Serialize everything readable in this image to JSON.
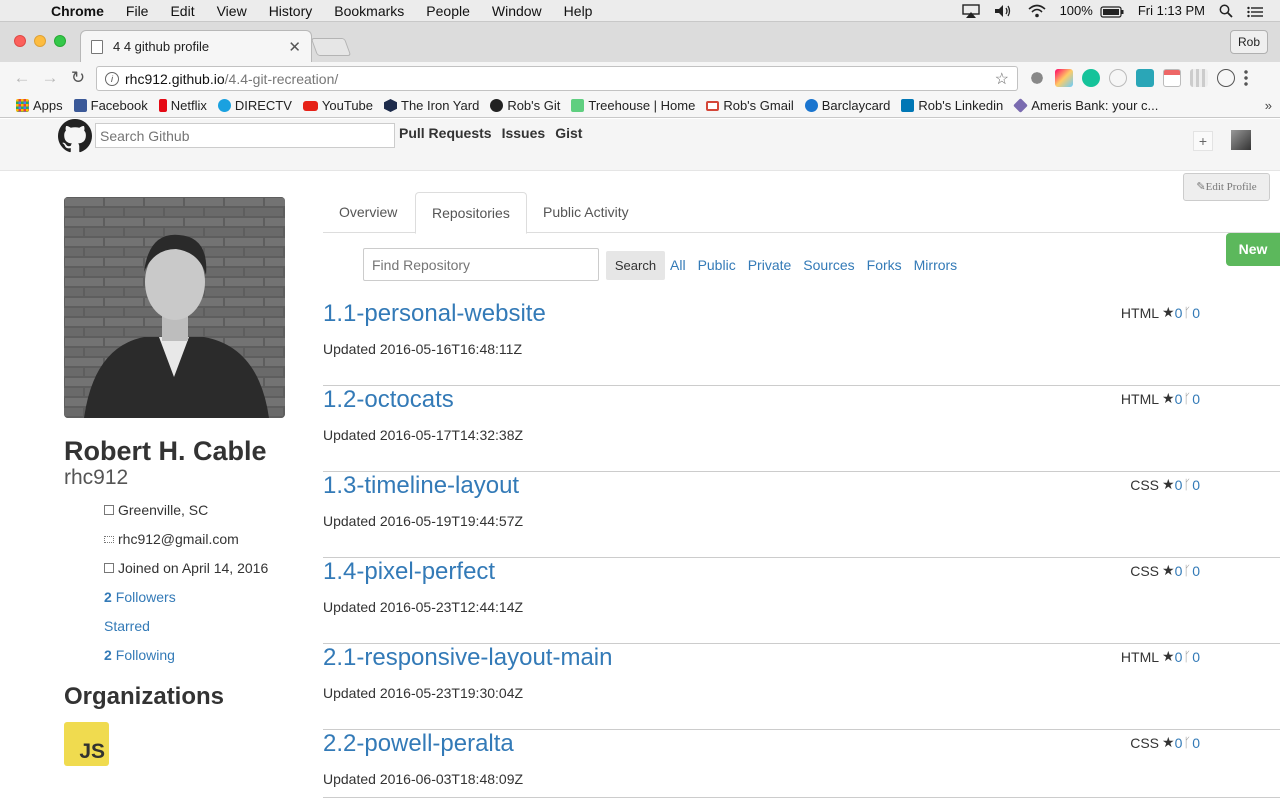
{
  "menubar": {
    "app": "Chrome",
    "items": [
      "File",
      "Edit",
      "View",
      "History",
      "Bookmarks",
      "People",
      "Window",
      "Help"
    ],
    "battery": "100%",
    "clock": "Fri 1:13 PM"
  },
  "browser": {
    "tab_title": "4 4 github profile",
    "profile_name": "Rob",
    "url_host": "rhc912.github.io",
    "url_path": "/4.4-git-recreation/",
    "bookmarks": [
      {
        "label": "Apps",
        "color": "#e94235"
      },
      {
        "label": "Facebook",
        "color": "#3b5998"
      },
      {
        "label": "Netflix",
        "color": "#e50914"
      },
      {
        "label": "DIRECTV",
        "color": "#1aa1e0"
      },
      {
        "label": "YouTube",
        "color": "#e62117"
      },
      {
        "label": "The Iron Yard",
        "color": "#1d2b4b"
      },
      {
        "label": "Rob's Git",
        "color": "#222222"
      },
      {
        "label": "Treehouse | Home",
        "color": "#5fcf80"
      },
      {
        "label": "Rob's Gmail",
        "color": "#d44638"
      },
      {
        "label": "Barclaycard",
        "color": "#1a75cf"
      },
      {
        "label": "Rob's Linkedin",
        "color": "#0077b5"
      },
      {
        "label": "Ameris Bank: your c...",
        "color": "#7a6bb0"
      }
    ],
    "bookmarks_more": "»"
  },
  "header": {
    "search_placeholder": "Search Github",
    "nav": [
      "Pull Requests",
      "Issues",
      "Gist"
    ],
    "plus": "+"
  },
  "profile": {
    "edit_label": "Edit Profile",
    "full_name": "Robert H. Cable",
    "username": "rhc912",
    "location": "Greenville, SC",
    "email": "rhc912@gmail.com",
    "joined": "Joined on April 14, 2016",
    "followers_count": "2",
    "followers_label": "Followers",
    "starred_label": "Starred",
    "following_count": "2",
    "following_label": "Following",
    "organizations_title": "Organizations",
    "org_badge": "JS"
  },
  "tabs": [
    "Overview",
    "Repositories",
    "Public Activity"
  ],
  "repo_controls": {
    "new_label": "New",
    "find_placeholder": "Find Repository",
    "search_label": "Search",
    "filters": [
      "All",
      "Public",
      "Private",
      "Sources",
      "Forks",
      "Mirrors"
    ]
  },
  "repos": [
    {
      "name": "1.1-personal-website",
      "updated": "Updated 2016-05-16T16:48:11Z",
      "lang": "HTML",
      "stars": "0",
      "forks": "0"
    },
    {
      "name": "1.2-octocats",
      "updated": "Updated 2016-05-17T14:32:38Z",
      "lang": "HTML",
      "stars": "0",
      "forks": "0"
    },
    {
      "name": "1.3-timeline-layout",
      "updated": "Updated 2016-05-19T19:44:57Z",
      "lang": "CSS",
      "stars": "0",
      "forks": "0"
    },
    {
      "name": "1.4-pixel-perfect",
      "updated": "Updated 2016-05-23T12:44:14Z",
      "lang": "CSS",
      "stars": "0",
      "forks": "0"
    },
    {
      "name": "2.1-responsive-layout-main",
      "updated": "Updated 2016-05-23T19:30:04Z",
      "lang": "HTML",
      "stars": "0",
      "forks": "0"
    },
    {
      "name": "2.2-powell-peralta",
      "updated": "Updated 2016-06-03T18:48:09Z",
      "lang": "CSS",
      "stars": "0",
      "forks": "0"
    }
  ]
}
